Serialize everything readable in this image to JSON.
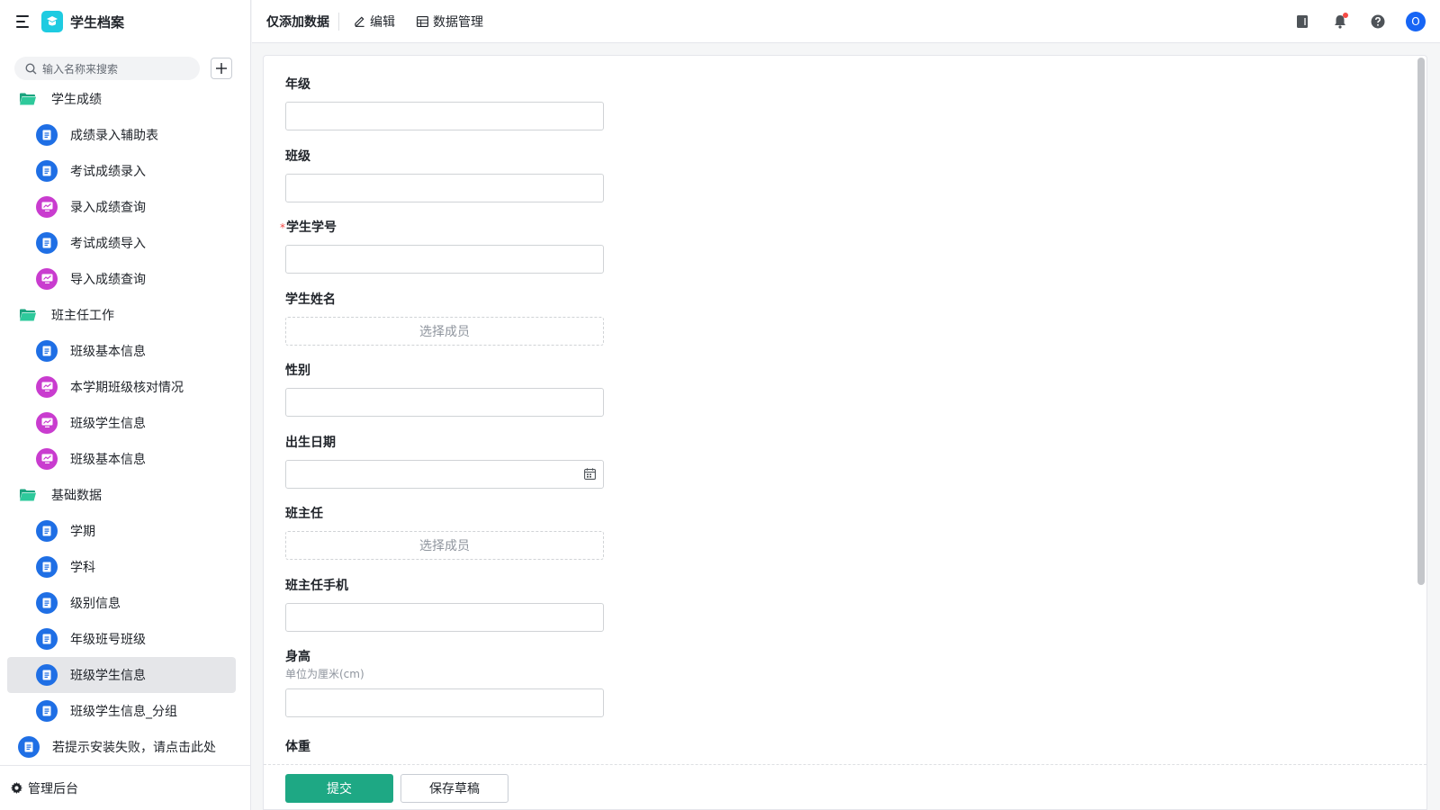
{
  "app": {
    "title": "学生档案",
    "brand_color": "#1ecbe1"
  },
  "sidebar": {
    "search_placeholder": "输入名称来搜索",
    "items": [
      {
        "type": "folder",
        "label": "学生成绩"
      },
      {
        "type": "doc",
        "label": "成绩录入辅助表"
      },
      {
        "type": "doc",
        "label": "考试成绩录入"
      },
      {
        "type": "chart",
        "label": "录入成绩查询"
      },
      {
        "type": "doc",
        "label": "考试成绩导入"
      },
      {
        "type": "chart",
        "label": "导入成绩查询"
      },
      {
        "type": "folder",
        "label": "班主任工作"
      },
      {
        "type": "doc",
        "label": "班级基本信息"
      },
      {
        "type": "chart",
        "label": "本学期班级核对情况"
      },
      {
        "type": "chart",
        "label": "班级学生信息"
      },
      {
        "type": "chart",
        "label": "班级基本信息"
      },
      {
        "type": "folder",
        "label": "基础数据"
      },
      {
        "type": "doc",
        "label": "学期"
      },
      {
        "type": "doc",
        "label": "学科"
      },
      {
        "type": "doc",
        "label": "级别信息"
      },
      {
        "type": "doc",
        "label": "年级班号班级"
      },
      {
        "type": "doc",
        "label": "班级学生信息",
        "active": true
      },
      {
        "type": "doc",
        "label": "班级学生信息_分组"
      },
      {
        "type": "root-doc",
        "label": "若提示安装失败，请点击此处"
      }
    ],
    "footer_label": "管理后台"
  },
  "topbar": {
    "title": "仅添加数据",
    "edit_label": "编辑",
    "data_manage_label": "数据管理",
    "avatar_initial": "O"
  },
  "form": {
    "fields": [
      {
        "label": "年级",
        "kind": "text",
        "required": false
      },
      {
        "label": "班级",
        "kind": "text",
        "required": false
      },
      {
        "label": "学生学号",
        "kind": "text",
        "required": true
      },
      {
        "label": "学生姓名",
        "kind": "member",
        "placeholder": "选择成员"
      },
      {
        "label": "性别",
        "kind": "text"
      },
      {
        "label": "出生日期",
        "kind": "date"
      },
      {
        "label": "班主任",
        "kind": "member",
        "placeholder": "选择成员"
      },
      {
        "label": "班主任手机",
        "kind": "text"
      },
      {
        "label": "身高",
        "kind": "text",
        "hint": "单位为厘米(cm)"
      },
      {
        "label": "体重",
        "kind": "text"
      }
    ],
    "required_mark": "*",
    "submit_label": "提交",
    "draft_label": "保存草稿",
    "submit_color": "#1ea884"
  }
}
